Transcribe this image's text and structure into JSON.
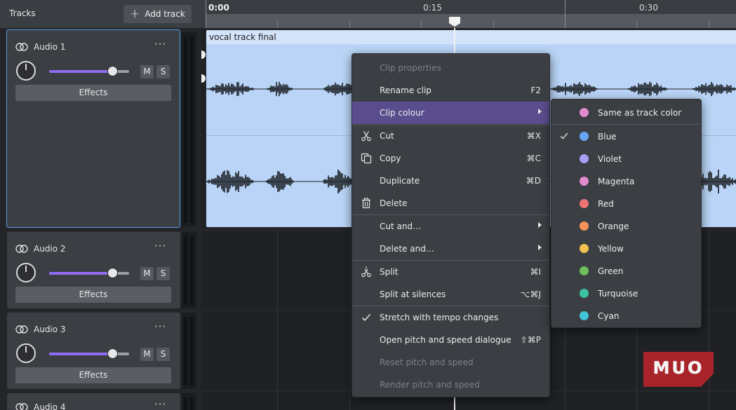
{
  "header": {
    "tracks_title": "Tracks",
    "add_track_label": "Add track"
  },
  "ruler": {
    "labels": [
      "0:00",
      "0:15",
      "0:30"
    ]
  },
  "tracks": [
    {
      "name": "Audio 1",
      "mute_label": "M",
      "solo_label": "S",
      "effects_label": "Effects",
      "volume": 0.79
    },
    {
      "name": "Audio 2",
      "mute_label": "M",
      "solo_label": "S",
      "effects_label": "Effects",
      "volume": 0.79
    },
    {
      "name": "Audio 3",
      "mute_label": "M",
      "solo_label": "S",
      "effects_label": "Effects",
      "volume": 0.79
    },
    {
      "name": "Audio 4"
    }
  ],
  "clip": {
    "name": "vocal track final",
    "color": "#b9d4f6"
  },
  "context_menu": {
    "items": [
      {
        "label": "Clip properties",
        "shortcut": "",
        "disabled": true
      },
      {
        "label": "Rename clip",
        "shortcut": "F2"
      },
      {
        "label": "Clip colour",
        "shortcut": ""
      },
      {
        "label": "Cut",
        "shortcut": "⌘X",
        "icon": "scissors-icon"
      },
      {
        "label": "Copy",
        "shortcut": "⌘C",
        "icon": "copy-icon"
      },
      {
        "label": "Duplicate",
        "shortcut": "⌘D"
      },
      {
        "label": "Delete",
        "shortcut": "",
        "icon": "trash-icon"
      },
      {
        "label": "Cut and…",
        "shortcut": ""
      },
      {
        "label": "Delete and…",
        "shortcut": ""
      },
      {
        "label": "Split",
        "shortcut": "⌘I",
        "icon": "split-scissors-icon"
      },
      {
        "label": "Split at silences",
        "shortcut": "⌥⌘J"
      },
      {
        "label": "Stretch with tempo changes",
        "shortcut": "",
        "checked": true
      },
      {
        "label": "Open pitch and speed dialogue",
        "shortcut": "⇧⌘P"
      },
      {
        "label": "Reset pitch and speed",
        "shortcut": "",
        "disabled": true
      },
      {
        "label": "Render pitch and speed",
        "shortcut": "",
        "disabled": true
      }
    ]
  },
  "colour_submenu": {
    "items": [
      {
        "label": "Same as track color",
        "color": "#e38ccd"
      },
      {
        "label": "Blue",
        "color": "#6aa6f5",
        "checked": true
      },
      {
        "label": "Violet",
        "color": "#a99cf5"
      },
      {
        "label": "Magenta",
        "color": "#e38ccd"
      },
      {
        "label": "Red",
        "color": "#ef7474"
      },
      {
        "label": "Orange",
        "color": "#f5935a"
      },
      {
        "label": "Yellow",
        "color": "#f1c24f"
      },
      {
        "label": "Green",
        "color": "#6fbe5c"
      },
      {
        "label": "Turquoise",
        "color": "#3cc1a1"
      },
      {
        "label": "Cyan",
        "color": "#42c4d8"
      }
    ]
  },
  "colors": {
    "accent": "#8f6cf2",
    "highlight": "#5a4d8e",
    "selection": "#5d9fe8"
  },
  "watermark": {
    "text": "MUO"
  }
}
